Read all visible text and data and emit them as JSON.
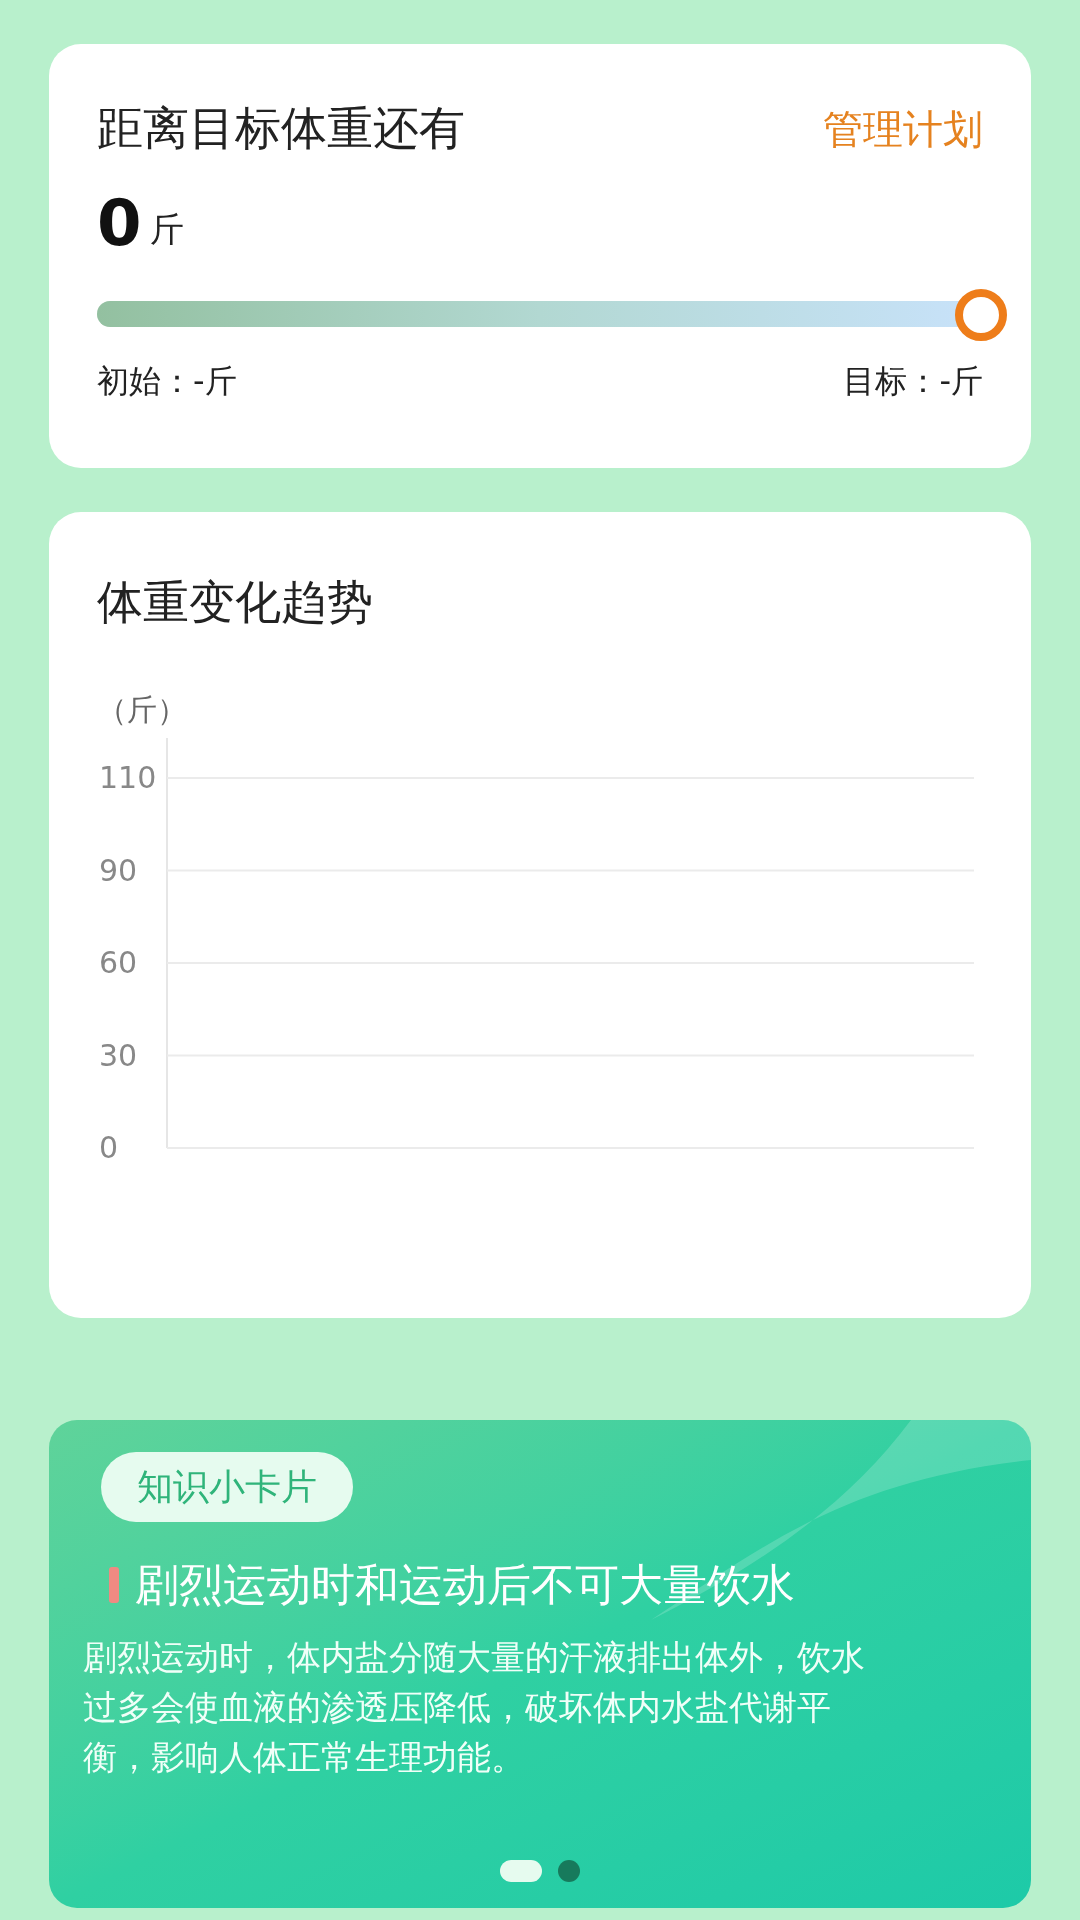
{
  "goal_card": {
    "title": "距离目标体重还有",
    "action": "管理计划",
    "remaining_value": "0",
    "remaining_unit": "斤",
    "progress": {
      "level": 1
    },
    "start_label": "初始：-斤",
    "target_label": "目标：-斤"
  },
  "trend_card": {
    "title": "体重变化趋势",
    "unit_label": "（斤）",
    "y_axis_labels": [
      "110",
      "90",
      "60",
      "30",
      "0"
    ]
  },
  "knowledge_card": {
    "tag": "知识小卡片",
    "headline": "剧烈运动时和运动后不可大量饮水",
    "body": "剧烈运动时，体内盐分随大量的汗液排出体外，饮水过多会使血液的渗透压降低，破坏体内水盐代谢平衡，影响人体正常生理功能。",
    "pages": [
      {
        "selected": true
      },
      {
        "selected": false
      }
    ]
  }
}
